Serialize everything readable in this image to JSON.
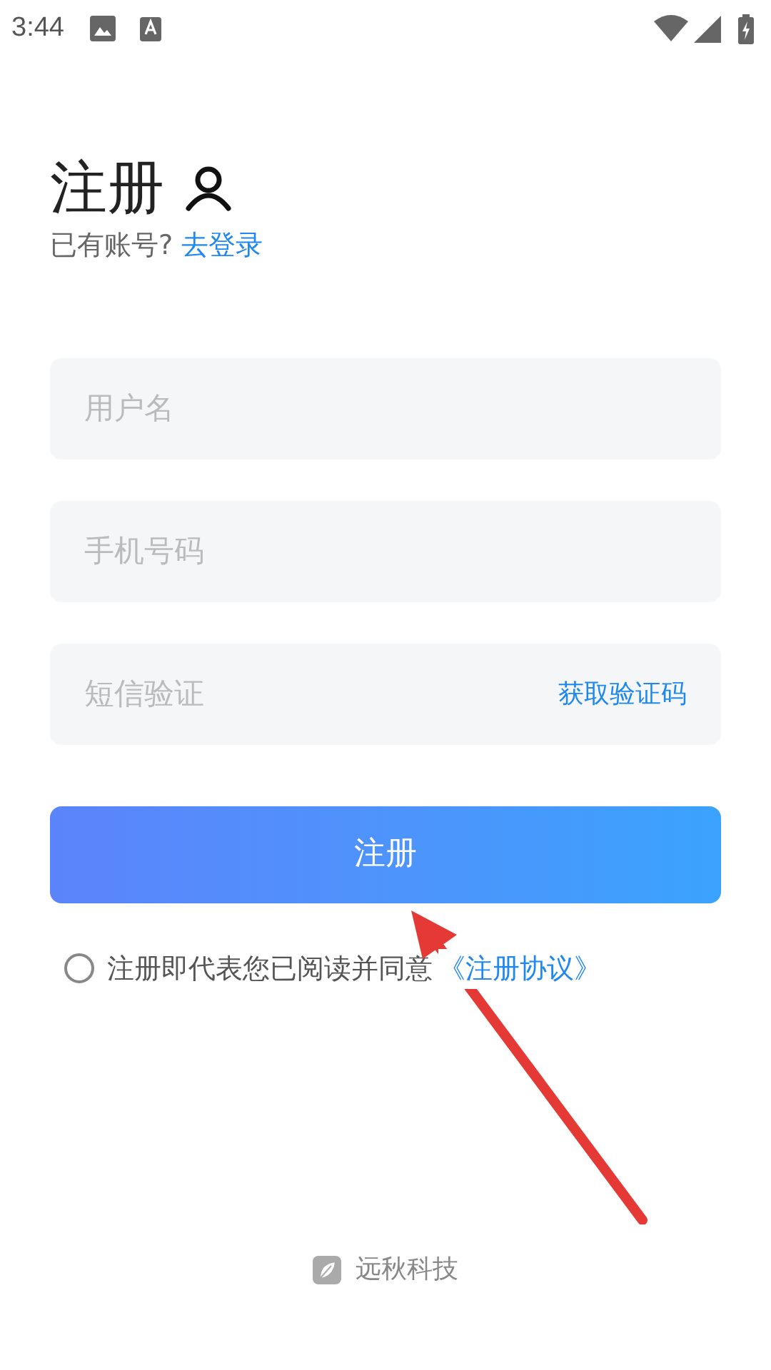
{
  "status_bar": {
    "time": "3:44"
  },
  "header": {
    "title": "注册",
    "prompt": "已有账号?",
    "login_link": "去登录"
  },
  "fields": [
    {
      "kind": "text",
      "placeholder": "用户名"
    },
    {
      "kind": "text",
      "placeholder": "手机号码"
    },
    {
      "kind": "code",
      "placeholder": "短信验证",
      "action": "获取验证码"
    }
  ],
  "submit": "注册",
  "agreement": {
    "checked": false,
    "text": "注册即代表您已阅读并同意",
    "link": "《注册协议》"
  },
  "footer": {
    "brand": "远秋科技"
  }
}
